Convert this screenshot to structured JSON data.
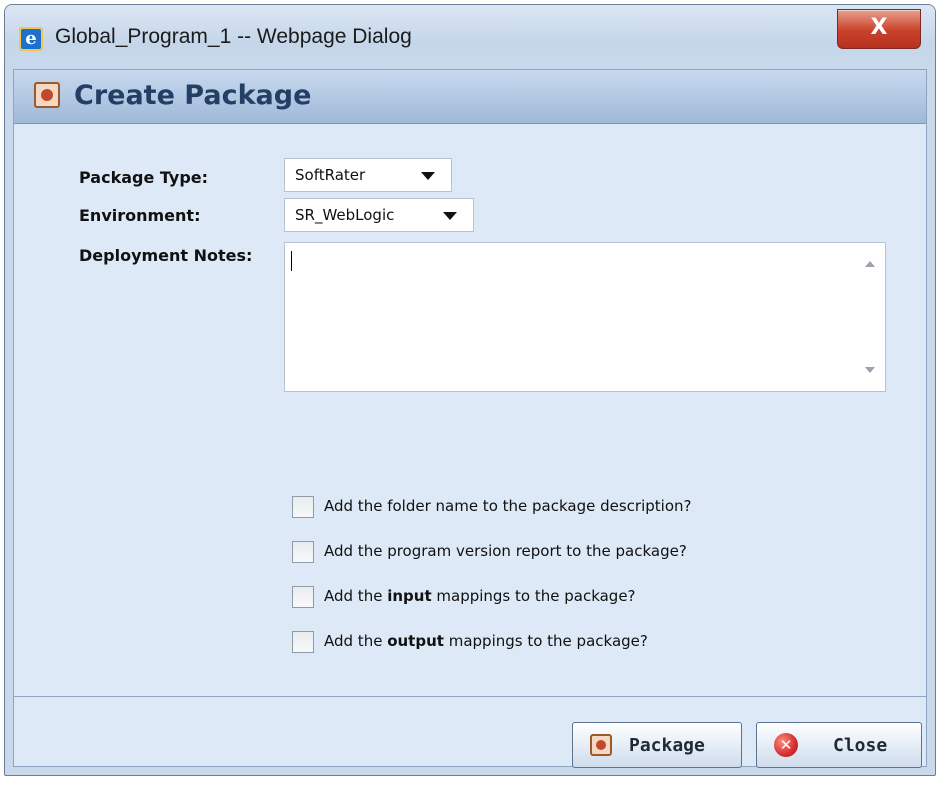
{
  "window": {
    "title": "Global_Program_1 -- Webpage Dialog",
    "close_glyph": "X",
    "ie_glyph": "e"
  },
  "panel": {
    "title": "Create Package"
  },
  "form": {
    "package_type_label": "Package Type:",
    "package_type_value": "SoftRater",
    "environment_label": "Environment:",
    "environment_value": "SR_WebLogic",
    "notes_label": "Deployment Notes:",
    "notes_value": ""
  },
  "options": [
    {
      "prefix": "Add the folder name to the package description?",
      "bold": "",
      "suffix": "",
      "checked": false
    },
    {
      "prefix": "Add the program version report to the package?",
      "bold": "",
      "suffix": "",
      "checked": false
    },
    {
      "prefix": "Add the ",
      "bold": "input",
      "suffix": " mappings to the package?",
      "checked": false
    },
    {
      "prefix": "Add the ",
      "bold": "output",
      "suffix": " mappings to the package?",
      "checked": false
    }
  ],
  "buttons": {
    "package_label": "Package",
    "close_label": "Close",
    "close_icon_glyph": "✕"
  }
}
